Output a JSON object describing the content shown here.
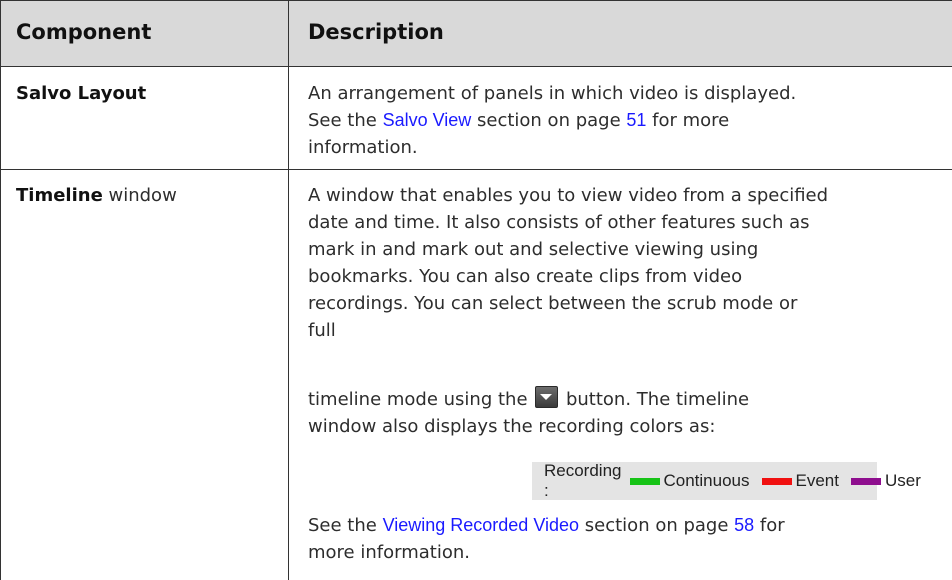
{
  "table": {
    "header": {
      "component": "Component",
      "description": "Description"
    },
    "rows": [
      {
        "component": "Salvo Layout",
        "description": {
          "line1": "An arrangement of panels in which video is displayed.",
          "line2_pre": "See the ",
          "link": "Salvo View",
          "line2_mid": "  section on page ",
          "page": "51",
          "line2_post": " for more",
          "line3": "information."
        }
      },
      {
        "component_bold": "Timeline",
        "component_rest": " window",
        "description": {
          "lines": [
            "A window that enables you to view video from a specified",
            "date and time. It also consists of other features such as",
            "mark in and mark out and selective viewing using",
            "bookmarks. You can also create clips from video",
            "recordings. You can select between the scrub mode or",
            "full"
          ],
          "mode_pre": "timeline mode using the ",
          "mode_post": " button. The timeline",
          "colors_line": "window also displays the recording colors as:",
          "see_pre": "See the ",
          "see_link": "Viewing Recorded Video",
          "see_mid": "  section on page ",
          "see_page": "58",
          "see_post": " for",
          "see_line2": "more information."
        }
      }
    ]
  },
  "legend": {
    "label": "Recording :",
    "items": [
      {
        "name": "Continuous",
        "color": "#16c316"
      },
      {
        "name": "Event",
        "color": "#f01010"
      },
      {
        "name": "User",
        "color": "#8e0e8e"
      }
    ]
  },
  "icons": {
    "dropdown": "dropdown-arrow-icon"
  },
  "colors": {
    "link": "#1a1aff",
    "header_bg": "#d9d9d9"
  }
}
